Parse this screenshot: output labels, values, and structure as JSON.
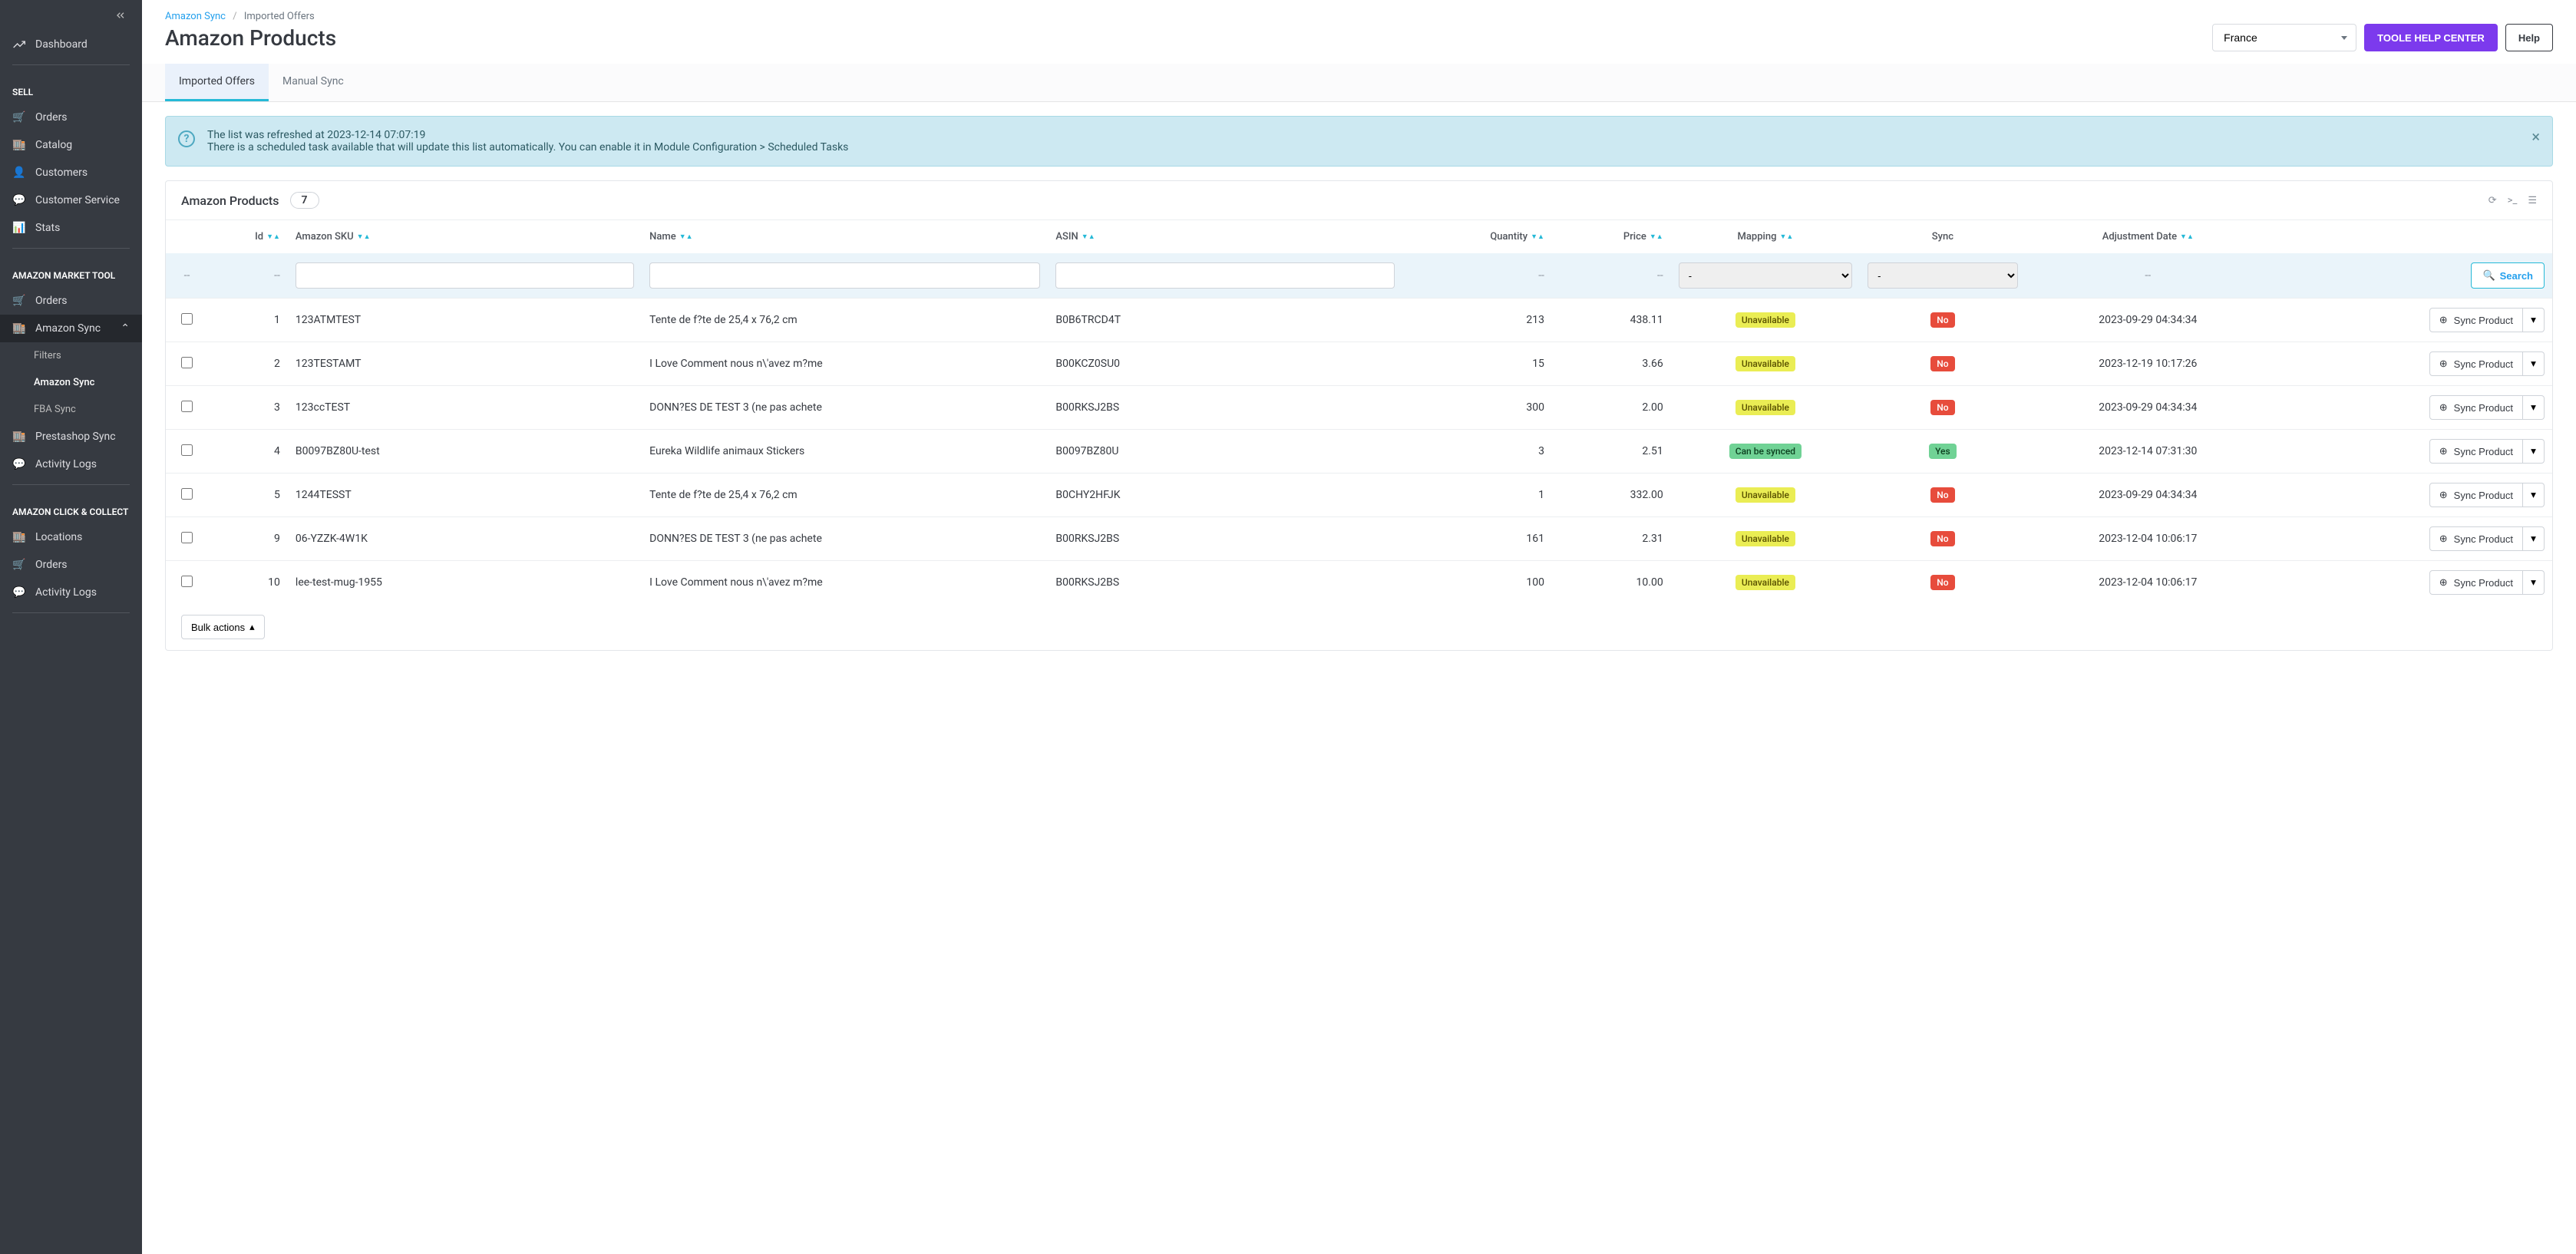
{
  "sidebar": {
    "top": {
      "label": "Dashboard"
    },
    "groups": [
      {
        "title": "SELL",
        "items": [
          {
            "label": "Orders"
          },
          {
            "label": "Catalog"
          },
          {
            "label": "Customers"
          },
          {
            "label": "Customer Service"
          },
          {
            "label": "Stats"
          }
        ]
      },
      {
        "title": "AMAZON MARKET TOOL",
        "items": [
          {
            "label": "Orders"
          },
          {
            "label": "Amazon Sync",
            "sub": [
              {
                "label": "Filters"
              },
              {
                "label": "Amazon Sync"
              },
              {
                "label": "FBA Sync"
              }
            ]
          },
          {
            "label": "Prestashop Sync"
          },
          {
            "label": "Activity Logs"
          }
        ]
      },
      {
        "title": "AMAZON CLICK & COLLECT",
        "items": [
          {
            "label": "Locations"
          },
          {
            "label": "Orders"
          },
          {
            "label": "Activity Logs"
          }
        ]
      }
    ]
  },
  "breadcrumb": {
    "a": "Amazon Sync",
    "b": "Imported Offers"
  },
  "header": {
    "title": "Amazon Products",
    "country": "France",
    "help_center": "TOOLE HELP CENTER",
    "help": "Help"
  },
  "tabs": {
    "imported": "Imported Offers",
    "manual": "Manual Sync"
  },
  "alert": {
    "line1": "The list was refreshed at 2023-12-14 07:07:19",
    "line2": "There is a scheduled task available that will update this list automatically. You can enable it in Module Configuration > Scheduled Tasks"
  },
  "panel": {
    "title": "Amazon Products",
    "count": "7",
    "search": "Search",
    "bulk": "Bulk actions",
    "sync_btn": "Sync Product",
    "dash": "--",
    "select_dash": "-",
    "cols": {
      "id": "Id",
      "sku": "Amazon SKU",
      "name": "Name",
      "asin": "ASIN",
      "qty": "Quantity",
      "price": "Price",
      "mapping": "Mapping",
      "sync": "Sync",
      "adj": "Adjustment Date"
    },
    "rows": [
      {
        "id": "1",
        "sku": "123ATMTEST",
        "name": "Tente de f?te de 25,4 x 76,2 cm",
        "asin": "B0B6TRCD4T",
        "qty": "213",
        "price": "438.11",
        "mapping": "Unavailable",
        "sync": "No",
        "adj": "2023-09-29 04:34:34"
      },
      {
        "id": "2",
        "sku": "123TESTAMT",
        "name": "I Love Comment nous n\\'avez m?me",
        "asin": "B00KCZ0SU0",
        "qty": "15",
        "price": "3.66",
        "mapping": "Unavailable",
        "sync": "No",
        "adj": "2023-12-19 10:17:26"
      },
      {
        "id": "3",
        "sku": "123ccTEST",
        "name": "DONN?ES DE TEST 3 (ne pas achete",
        "asin": "B00RKSJ2BS",
        "qty": "300",
        "price": "2.00",
        "mapping": "Unavailable",
        "sync": "No",
        "adj": "2023-09-29 04:34:34"
      },
      {
        "id": "4",
        "sku": "B0097BZ80U-test",
        "name": "Eureka Wildlife animaux Stickers",
        "asin": "B0097BZ80U",
        "qty": "3",
        "price": "2.51",
        "mapping": "Can be synced",
        "sync": "Yes",
        "adj": "2023-12-14 07:31:30"
      },
      {
        "id": "5",
        "sku": "1244TESST",
        "name": "Tente de f?te de 25,4 x 76,2 cm",
        "asin": "B0CHY2HFJK",
        "qty": "1",
        "price": "332.00",
        "mapping": "Unavailable",
        "sync": "No",
        "adj": "2023-09-29 04:34:34"
      },
      {
        "id": "9",
        "sku": "06-YZZK-4W1K",
        "name": "DONN?ES DE TEST 3 (ne pas achete",
        "asin": "B00RKSJ2BS",
        "qty": "161",
        "price": "2.31",
        "mapping": "Unavailable",
        "sync": "No",
        "adj": "2023-12-04 10:06:17"
      },
      {
        "id": "10",
        "sku": "lee-test-mug-1955",
        "name": "I Love Comment nous n\\'avez m?me",
        "asin": "B00RKSJ2BS",
        "qty": "100",
        "price": "10.00",
        "mapping": "Unavailable",
        "sync": "No",
        "adj": "2023-12-04 10:06:17"
      }
    ]
  }
}
